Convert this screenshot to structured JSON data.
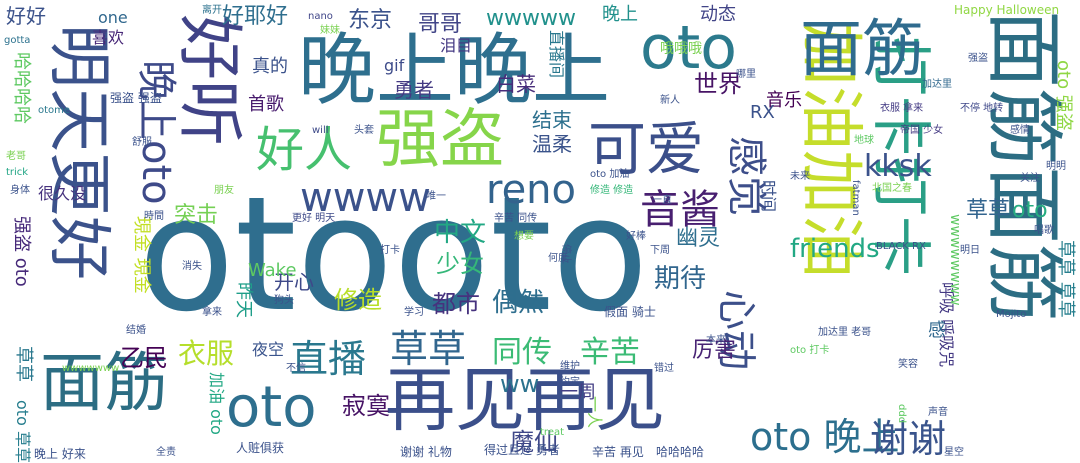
{
  "words": [
    {
      "text": "otooto",
      "color": "#2f6e8e"
    },
    {
      "text": "面筋面筋",
      "color": "#2c6d83"
    },
    {
      "text": "晚上晚上",
      "color": "#2e6f8e"
    },
    {
      "text": "再见再见",
      "color": "#3b4f8a"
    },
    {
      "text": "明天更好",
      "color": "#3b528b"
    },
    {
      "text": "好听",
      "color": "#404387"
    },
    {
      "text": "加油加油",
      "color": "#c5dd2b"
    },
    {
      "text": "打卡打卡",
      "color": "#2a9f86"
    },
    {
      "text": "面筋",
      "color": "#2c6d83"
    },
    {
      "text": "oto",
      "color": "#2c7a8d"
    },
    {
      "text": "强盗",
      "color": "#86d54a"
    },
    {
      "text": "可爱",
      "color": "#3b4f8a"
    },
    {
      "text": "好人",
      "color": "#46c06f"
    },
    {
      "text": "面筋",
      "color": "#2f6b8e"
    },
    {
      "text": "oto",
      "color": "#2e6f8e"
    },
    {
      "text": "晚上oto",
      "color": "#3e4a89"
    },
    {
      "text": "wwww",
      "color": "#3b528b"
    },
    {
      "text": "reno",
      "color": "#33638d"
    },
    {
      "text": "音酱",
      "color": "#481f70"
    },
    {
      "text": "感觉",
      "color": "#3d4e8a"
    },
    {
      "text": "心动",
      "color": "#3c4f8a"
    },
    {
      "text": "oto 晚上",
      "color": "#2c6f8e"
    },
    {
      "text": "谢谢",
      "color": "#3a548c"
    },
    {
      "text": "直播",
      "color": "#2a788e"
    },
    {
      "text": "草草",
      "color": "#31668e"
    },
    {
      "text": "同传",
      "color": "#3bbb75"
    },
    {
      "text": "辛苦",
      "color": "#3bbb75"
    },
    {
      "text": "衣服",
      "color": "#b5de2b"
    },
    {
      "text": "中文",
      "color": "#22a884"
    },
    {
      "text": "kksk",
      "color": "#3b528b"
    },
    {
      "text": "friends",
      "color": "#22a884"
    },
    {
      "text": "期待",
      "color": "#31668e"
    },
    {
      "text": "偶然",
      "color": "#2e6e8e"
    },
    {
      "text": "少女",
      "color": "#35b779"
    },
    {
      "text": "修造",
      "color": "#b8de29"
    },
    {
      "text": "都市",
      "color": "#46327e"
    },
    {
      "text": "乙民",
      "color": "#440154"
    },
    {
      "text": "寂寞",
      "color": "#471365"
    },
    {
      "text": "魔仙",
      "color": "#3f4788"
    },
    {
      "text": "ww",
      "color": "#2c728e"
    },
    {
      "text": "一周",
      "color": "#433e85"
    },
    {
      "text": "厉害",
      "color": "#482374"
    },
    {
      "text": "突击",
      "color": "#75d054"
    },
    {
      "text": "好好",
      "color": "#3b528b"
    },
    {
      "text": "好耶好",
      "color": "#2e6e8e"
    },
    {
      "text": "东京",
      "color": "#3b528b"
    },
    {
      "text": "哥哥",
      "color": "#414487"
    },
    {
      "text": "wwwww",
      "color": "#21918c"
    },
    {
      "text": "晚上",
      "color": "#21918c"
    },
    {
      "text": "动态",
      "color": "#414487"
    },
    {
      "text": "世界",
      "color": "#471365"
    },
    {
      "text": "白菜",
      "color": "#472c7a"
    },
    {
      "text": "勇者",
      "color": "#443a83"
    },
    {
      "text": "真的",
      "color": "#3b528b"
    },
    {
      "text": "首歌",
      "color": "#481b6d"
    },
    {
      "text": "温柔",
      "color": "#3a538b"
    },
    {
      "text": "结束",
      "color": "#2d708e"
    },
    {
      "text": "音乐",
      "color": "#440154"
    },
    {
      "text": "幽灵",
      "color": "#2e6e8e"
    },
    {
      "text": "开心",
      "color": "#3e4989"
    },
    {
      "text": "Wake",
      "color": "#5ec962"
    },
    {
      "text": "RX",
      "color": "#3b528b"
    },
    {
      "text": "oto",
      "color": "#27ad81"
    },
    {
      "text": "草草",
      "color": "#32648e"
    },
    {
      "text": "oto 强盗",
      "color": "#8fd744"
    },
    {
      "text": "草草 草草",
      "color": "#277f8e"
    },
    {
      "text": "草草",
      "color": "#2a788e"
    },
    {
      "text": "oto 草草",
      "color": "#277e8e"
    },
    {
      "text": "强盗 oto",
      "color": "#472a7a"
    },
    {
      "text": "現金 現金",
      "color": "#c2df23"
    },
    {
      "text": "哈哈哈哈",
      "color": "#5ec962"
    },
    {
      "text": "很久没",
      "color": "#46327e"
    },
    {
      "text": "one",
      "color": "#31688e"
    },
    {
      "text": "喜欢",
      "color": "#482878"
    },
    {
      "text": "gif",
      "color": "#3e4c8a"
    },
    {
      "text": "泪目",
      "color": "#443983"
    },
    {
      "text": "夜空",
      "color": "#3a548c"
    },
    {
      "text": "加油 oto",
      "color": "#22a884"
    },
    {
      "text": "昨天",
      "color": "#1f9e89"
    },
    {
      "text": "哦哦哦",
      "color": "#7ad151"
    },
    {
      "text": "直播间",
      "color": "#2a788e"
    },
    {
      "text": "呼吸 呼吸咒",
      "color": "#443983"
    },
    {
      "text": "感",
      "color": "#31688e"
    },
    {
      "text": "时间",
      "color": "#3b528b"
    },
    {
      "text": "Happy Halloween",
      "color": "#90d743"
    },
    {
      "text": "离开",
      "color": "#2c728e"
    },
    {
      "text": "nano",
      "color": "#404688"
    },
    {
      "text": "妹妹",
      "color": "#7ad151"
    },
    {
      "text": "衣服 拿来",
      "color": "#443b84"
    },
    {
      "text": "加达里",
      "color": "#31688e"
    },
    {
      "text": "帝国 少女",
      "color": "#443a83"
    },
    {
      "text": "不停 地转",
      "color": "#3f4889"
    },
    {
      "text": "强盗",
      "color": "#3b528b"
    },
    {
      "text": "强盗 强盗",
      "color": "#3b528b"
    },
    {
      "text": "otome",
      "color": "#2a788e"
    },
    {
      "text": "舒服",
      "color": "#3b528b"
    },
    {
      "text": "老哥",
      "color": "#7ad151"
    },
    {
      "text": "trick",
      "color": "#21a585"
    },
    {
      "text": "身体",
      "color": "#3b528b"
    },
    {
      "text": "gotta",
      "color": "#2c728e"
    },
    {
      "text": "will",
      "color": "#3e4a89"
    },
    {
      "text": "头套",
      "color": "#3b528b"
    },
    {
      "text": "朋友",
      "color": "#7ad151"
    },
    {
      "text": "時間",
      "color": "#3b528b"
    },
    {
      "text": "更好 明天",
      "color": "#3e4a89"
    },
    {
      "text": "狗头",
      "color": "#3b528b"
    },
    {
      "text": "结婚",
      "color": "#3b528b"
    },
    {
      "text": "消失",
      "color": "#3b528b"
    },
    {
      "text": "不信",
      "color": "#3b528b"
    },
    {
      "text": "拿来",
      "color": "#3b528b"
    },
    {
      "text": "学习",
      "color": "#3b528b"
    },
    {
      "text": "打卡",
      "color": "#3b528b"
    },
    {
      "text": "唯一",
      "color": "#3b528b"
    },
    {
      "text": "辛苦 同传",
      "color": "#3b528b"
    },
    {
      "text": "想要",
      "color": "#7ad151"
    },
    {
      "text": "修造 修造",
      "color": "#35b779"
    },
    {
      "text": "oto 加油",
      "color": "#3b528b"
    },
    {
      "text": "新人",
      "color": "#3b528b"
    },
    {
      "text": "哪里",
      "color": "#3b528b"
    },
    {
      "text": "地球",
      "color": "#5ec962"
    },
    {
      "text": "感情",
      "color": "#3b528b"
    },
    {
      "text": "未来",
      "color": "#3b528b"
    },
    {
      "text": "北国之春",
      "color": "#7ad151"
    },
    {
      "text": "关注",
      "color": "#3b528b"
    },
    {
      "text": "明明",
      "color": "#3b528b"
    },
    {
      "text": "唱歌",
      "color": "#3b528b"
    },
    {
      "text": "fatman",
      "color": "#3b528b"
    },
    {
      "text": "BLACK RX",
      "color": "#3b528b"
    },
    {
      "text": "Mojito",
      "color": "#3b528b"
    },
    {
      "text": "加达里 老哥",
      "color": "#3b528b"
    },
    {
      "text": "笑容",
      "color": "#3b528b"
    },
    {
      "text": "声音",
      "color": "#3b528b"
    },
    {
      "text": "星空",
      "color": "#3b528b"
    },
    {
      "text": "oto 打卡",
      "color": "#5ec962"
    },
    {
      "text": "本来",
      "color": "#3b528b"
    },
    {
      "text": "维护",
      "color": "#3b528b"
    },
    {
      "text": "约定",
      "color": "#3b528b"
    },
    {
      "text": "错过",
      "color": "#3b528b"
    },
    {
      "text": "treat",
      "color": "#5ec962"
    },
    {
      "text": "得过且过 勇者",
      "color": "#3b528b"
    },
    {
      "text": "谢谢 礼物",
      "color": "#3b528b"
    },
    {
      "text": "辛苦 再见",
      "color": "#3b528b"
    },
    {
      "text": "哈哈哈哈",
      "color": "#3b528b"
    },
    {
      "text": "人赃俱获",
      "color": "#3b528b"
    },
    {
      "text": "晚上 好来",
      "color": "#3b528b"
    },
    {
      "text": "全责",
      "color": "#3b528b"
    },
    {
      "text": "一人",
      "color": "#7ad151"
    },
    {
      "text": "好棒",
      "color": "#3b528b"
    },
    {
      "text": "下周",
      "color": "#3b528b"
    },
    {
      "text": "停止",
      "color": "#3b528b"
    },
    {
      "text": "何度",
      "color": "#3b528b"
    },
    {
      "text": "假面 骑士",
      "color": "#3b528b"
    },
    {
      "text": "ddd",
      "color": "#5ec962"
    },
    {
      "text": "wwwwwwww",
      "color": "#5ec962"
    },
    {
      "text": "wwwwwww",
      "color": "#7ad151"
    },
    {
      "text": "一直",
      "color": "#3b528b"
    },
    {
      "text": "明日",
      "color": "#3b528b"
    }
  ]
}
